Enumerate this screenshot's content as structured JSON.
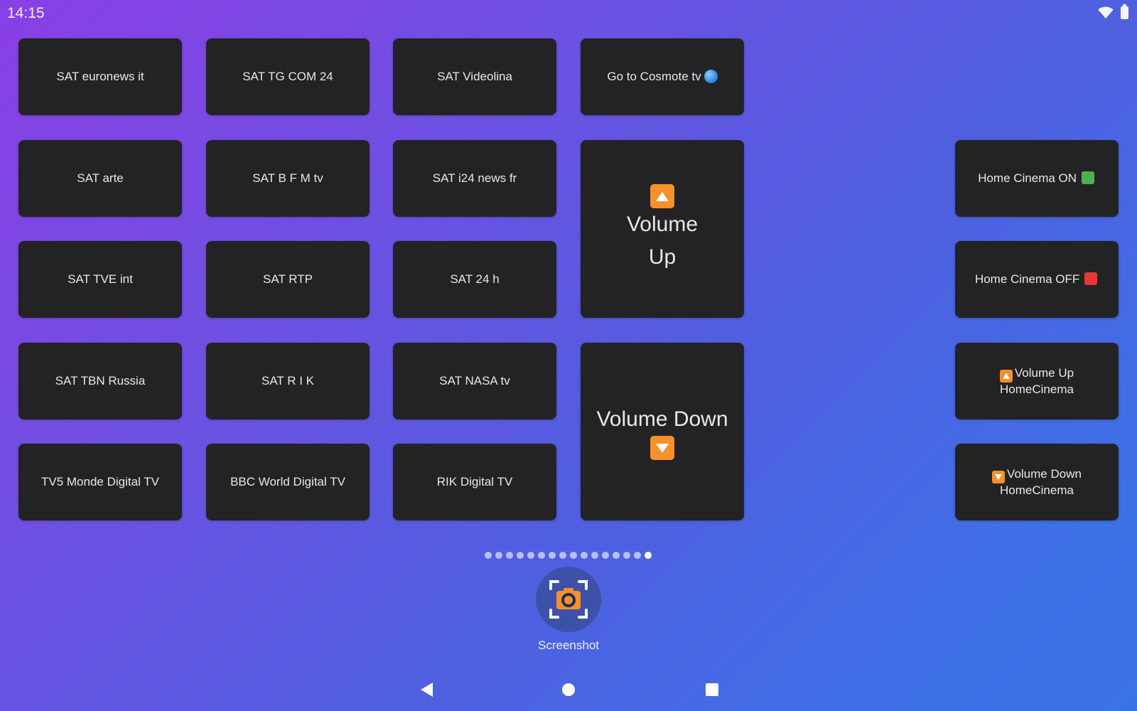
{
  "status_bar": {
    "time": "14:15",
    "icons": [
      "wifi-icon",
      "battery-icon"
    ]
  },
  "tiles": [
    {
      "id": "sat-euronews-it",
      "label": "SAT euronews it"
    },
    {
      "id": "sat-tg-com-24",
      "label": "SAT TG COM 24"
    },
    {
      "id": "sat-videolina",
      "label": "SAT Videolina"
    },
    {
      "id": "go-to-cosmote-tv",
      "label": "Go to Cosmote tv",
      "icon": "globe-icon"
    },
    {
      "id": "sat-arte",
      "label": "SAT arte"
    },
    {
      "id": "sat-bfm-tv",
      "label": "SAT B F M tv"
    },
    {
      "id": "sat-i24-news-fr",
      "label": "SAT i24 news fr"
    },
    {
      "id": "volume-up",
      "label_line1": "Volume",
      "label_line2": "Up",
      "icon": "arrow-up-icon"
    },
    {
      "id": "sat-tve-int",
      "label": "SAT TVE int"
    },
    {
      "id": "sat-rtp",
      "label": "SAT RTP"
    },
    {
      "id": "sat-24-h",
      "label": "SAT 24 h"
    },
    {
      "id": "sat-tbn-russia",
      "label": "SAT TBN Russia"
    },
    {
      "id": "sat-rik",
      "label": "SAT R I K"
    },
    {
      "id": "sat-nasa-tv",
      "label": "SAT NASA tv"
    },
    {
      "id": "volume-down",
      "label": "Volume Down",
      "icon": "arrow-down-icon"
    },
    {
      "id": "tv5-monde-digital-tv",
      "label": "TV5 Monde Digital TV"
    },
    {
      "id": "bbc-world-digital-tv",
      "label": "BBC World Digital TV"
    },
    {
      "id": "rik-digital-tv",
      "label": "RIK Digital TV"
    },
    {
      "id": "home-cinema-on",
      "label": "Home Cinema ON",
      "icon": "green-square-icon",
      "icon_color": "#4caf50"
    },
    {
      "id": "home-cinema-off",
      "label": "Home Cinema OFF",
      "icon": "red-square-icon",
      "icon_color": "#e53935"
    },
    {
      "id": "volume-up-homecinema",
      "label_line1": "Volume Up",
      "label_line2": "HomeCinema",
      "icon": "arrow-up-icon"
    },
    {
      "id": "volume-down-homecinema",
      "label_line1": "Volume Down",
      "label_line2": "HomeCinema",
      "icon": "arrow-down-icon"
    }
  ],
  "page_indicator": {
    "total": 16,
    "active_index": 15
  },
  "dock": {
    "app_label": "Screenshot",
    "app_icon": "camera-icon",
    "accent": "#f5902b"
  },
  "nav_bar": {
    "buttons": [
      "back-icon",
      "home-icon",
      "recents-icon"
    ]
  },
  "colors": {
    "tile_bg": "#232325",
    "arrow_accent": "#f5902b"
  }
}
